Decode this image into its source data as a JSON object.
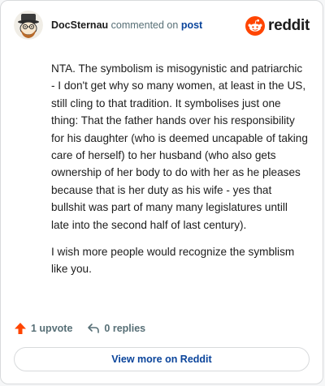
{
  "header": {
    "username": "DocSternau",
    "action_text": "commented on",
    "post_link": "post",
    "logo_text": "reddit"
  },
  "comment": {
    "paragraphs": [
      "NTA. The symbolism is misogynistic and patriarchic - I don't get why so many women, at least in the US, still cling to that tradition. It symbolises just one thing: That the father hands over his responsibility for his daughter (who is deemed uncapable of taking care of herself) to her husband (who also gets ownership of her body to do with her as he pleases because that is her duty as his wife - yes that bullshit was part of many many legislatures untill late into the second half of last century).",
      "I wish more people would recognize the symblism like you."
    ]
  },
  "actions": {
    "upvote_label": "1 upvote",
    "replies_label": "0 replies"
  },
  "footer": {
    "view_more_label": "View more on Reddit"
  },
  "colors": {
    "brand": "#ff4500",
    "link": "#0a449b",
    "meta": "#576f76",
    "border": "#d8dadc"
  },
  "icons": {
    "avatar": "snoo-avatar",
    "logo": "reddit-snoo-icon",
    "upvote": "upvote-arrow-icon",
    "reply": "reply-arrow-icon"
  }
}
